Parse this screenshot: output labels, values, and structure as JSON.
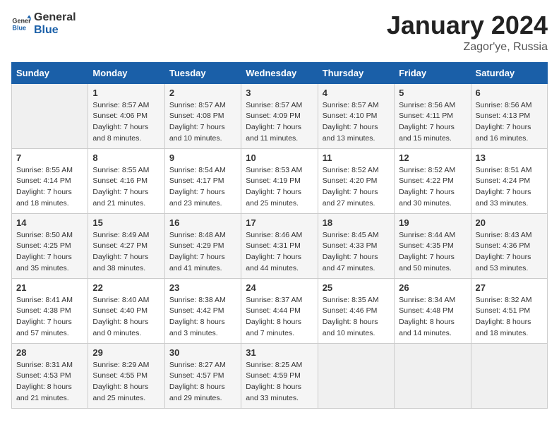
{
  "logo": {
    "general": "General",
    "blue": "Blue"
  },
  "title": "January 2024",
  "location": "Zagor'ye, Russia",
  "days_of_week": [
    "Sunday",
    "Monday",
    "Tuesday",
    "Wednesday",
    "Thursday",
    "Friday",
    "Saturday"
  ],
  "weeks": [
    [
      {
        "day": "",
        "sunrise": "",
        "sunset": "",
        "daylight": ""
      },
      {
        "day": "1",
        "sunrise": "8:57 AM",
        "sunset": "4:06 PM",
        "daylight": "7 hours and 8 minutes."
      },
      {
        "day": "2",
        "sunrise": "8:57 AM",
        "sunset": "4:08 PM",
        "daylight": "7 hours and 10 minutes."
      },
      {
        "day": "3",
        "sunrise": "8:57 AM",
        "sunset": "4:09 PM",
        "daylight": "7 hours and 11 minutes."
      },
      {
        "day": "4",
        "sunrise": "8:57 AM",
        "sunset": "4:10 PM",
        "daylight": "7 hours and 13 minutes."
      },
      {
        "day": "5",
        "sunrise": "8:56 AM",
        "sunset": "4:11 PM",
        "daylight": "7 hours and 15 minutes."
      },
      {
        "day": "6",
        "sunrise": "8:56 AM",
        "sunset": "4:13 PM",
        "daylight": "7 hours and 16 minutes."
      }
    ],
    [
      {
        "day": "7",
        "sunrise": "8:55 AM",
        "sunset": "4:14 PM",
        "daylight": "7 hours and 18 minutes."
      },
      {
        "day": "8",
        "sunrise": "8:55 AM",
        "sunset": "4:16 PM",
        "daylight": "7 hours and 21 minutes."
      },
      {
        "day": "9",
        "sunrise": "8:54 AM",
        "sunset": "4:17 PM",
        "daylight": "7 hours and 23 minutes."
      },
      {
        "day": "10",
        "sunrise": "8:53 AM",
        "sunset": "4:19 PM",
        "daylight": "7 hours and 25 minutes."
      },
      {
        "day": "11",
        "sunrise": "8:52 AM",
        "sunset": "4:20 PM",
        "daylight": "7 hours and 27 minutes."
      },
      {
        "day": "12",
        "sunrise": "8:52 AM",
        "sunset": "4:22 PM",
        "daylight": "7 hours and 30 minutes."
      },
      {
        "day": "13",
        "sunrise": "8:51 AM",
        "sunset": "4:24 PM",
        "daylight": "7 hours and 33 minutes."
      }
    ],
    [
      {
        "day": "14",
        "sunrise": "8:50 AM",
        "sunset": "4:25 PM",
        "daylight": "7 hours and 35 minutes."
      },
      {
        "day": "15",
        "sunrise": "8:49 AM",
        "sunset": "4:27 PM",
        "daylight": "7 hours and 38 minutes."
      },
      {
        "day": "16",
        "sunrise": "8:48 AM",
        "sunset": "4:29 PM",
        "daylight": "7 hours and 41 minutes."
      },
      {
        "day": "17",
        "sunrise": "8:46 AM",
        "sunset": "4:31 PM",
        "daylight": "7 hours and 44 minutes."
      },
      {
        "day": "18",
        "sunrise": "8:45 AM",
        "sunset": "4:33 PM",
        "daylight": "7 hours and 47 minutes."
      },
      {
        "day": "19",
        "sunrise": "8:44 AM",
        "sunset": "4:35 PM",
        "daylight": "7 hours and 50 minutes."
      },
      {
        "day": "20",
        "sunrise": "8:43 AM",
        "sunset": "4:36 PM",
        "daylight": "7 hours and 53 minutes."
      }
    ],
    [
      {
        "day": "21",
        "sunrise": "8:41 AM",
        "sunset": "4:38 PM",
        "daylight": "7 hours and 57 minutes."
      },
      {
        "day": "22",
        "sunrise": "8:40 AM",
        "sunset": "4:40 PM",
        "daylight": "8 hours and 0 minutes."
      },
      {
        "day": "23",
        "sunrise": "8:38 AM",
        "sunset": "4:42 PM",
        "daylight": "8 hours and 3 minutes."
      },
      {
        "day": "24",
        "sunrise": "8:37 AM",
        "sunset": "4:44 PM",
        "daylight": "8 hours and 7 minutes."
      },
      {
        "day": "25",
        "sunrise": "8:35 AM",
        "sunset": "4:46 PM",
        "daylight": "8 hours and 10 minutes."
      },
      {
        "day": "26",
        "sunrise": "8:34 AM",
        "sunset": "4:48 PM",
        "daylight": "8 hours and 14 minutes."
      },
      {
        "day": "27",
        "sunrise": "8:32 AM",
        "sunset": "4:51 PM",
        "daylight": "8 hours and 18 minutes."
      }
    ],
    [
      {
        "day": "28",
        "sunrise": "8:31 AM",
        "sunset": "4:53 PM",
        "daylight": "8 hours and 21 minutes."
      },
      {
        "day": "29",
        "sunrise": "8:29 AM",
        "sunset": "4:55 PM",
        "daylight": "8 hours and 25 minutes."
      },
      {
        "day": "30",
        "sunrise": "8:27 AM",
        "sunset": "4:57 PM",
        "daylight": "8 hours and 29 minutes."
      },
      {
        "day": "31",
        "sunrise": "8:25 AM",
        "sunset": "4:59 PM",
        "daylight": "8 hours and 33 minutes."
      },
      {
        "day": "",
        "sunrise": "",
        "sunset": "",
        "daylight": ""
      },
      {
        "day": "",
        "sunrise": "",
        "sunset": "",
        "daylight": ""
      },
      {
        "day": "",
        "sunrise": "",
        "sunset": "",
        "daylight": ""
      }
    ]
  ],
  "labels": {
    "sunrise_prefix": "Sunrise: ",
    "sunset_prefix": "Sunset: ",
    "daylight_label": "Daylight: "
  }
}
